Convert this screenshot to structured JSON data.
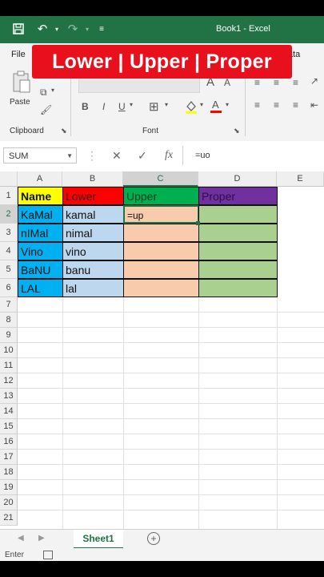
{
  "window": {
    "title": "Book1  -  Excel"
  },
  "ribbon": {
    "tabs": {
      "file": "File",
      "data": "ata"
    },
    "clipboard_label": "Clipboard",
    "paste_label": "Paste",
    "font_label": "Font",
    "bold": "B",
    "italic": "I",
    "underline": "U"
  },
  "banner": {
    "text": "Lower | Upper | Proper"
  },
  "formula_bar": {
    "name_box": "SUM",
    "cancel": "✕",
    "enter": "✓",
    "fx": "fx",
    "value": "=uo"
  },
  "columns": [
    "A",
    "B",
    "C",
    "D",
    "E"
  ],
  "rows": [
    "1",
    "2",
    "3",
    "4",
    "5",
    "6",
    "7",
    "8",
    "9",
    "10",
    "11",
    "12",
    "13",
    "14",
    "15",
    "16",
    "17",
    "18",
    "19",
    "20",
    "21"
  ],
  "table": {
    "headers": [
      "Name",
      "Lower",
      "Upper",
      "Proper"
    ],
    "rows": [
      [
        "KaMal",
        "kamal",
        "=up",
        ""
      ],
      [
        "nIMal",
        "nimal",
        "",
        ""
      ],
      [
        "Vino",
        "vino",
        "",
        ""
      ],
      [
        "BaNU",
        "banu",
        "",
        ""
      ],
      [
        "LAL",
        "lal",
        "",
        ""
      ]
    ]
  },
  "colors": {
    "name_header": "#ffff00",
    "lower_header": "#ff0000",
    "upper_header": "#00b050",
    "proper_header": "#7030a0",
    "name_cells": "#00b0f0",
    "lower_cells": "#bdd7ee",
    "upper_cells": "#f8cbad",
    "proper_cells": "#a9d08e",
    "excel_green": "#217346",
    "banner_red": "#e8101c"
  },
  "sheets": {
    "active": "Sheet1"
  },
  "status": {
    "mode": "Enter"
  }
}
